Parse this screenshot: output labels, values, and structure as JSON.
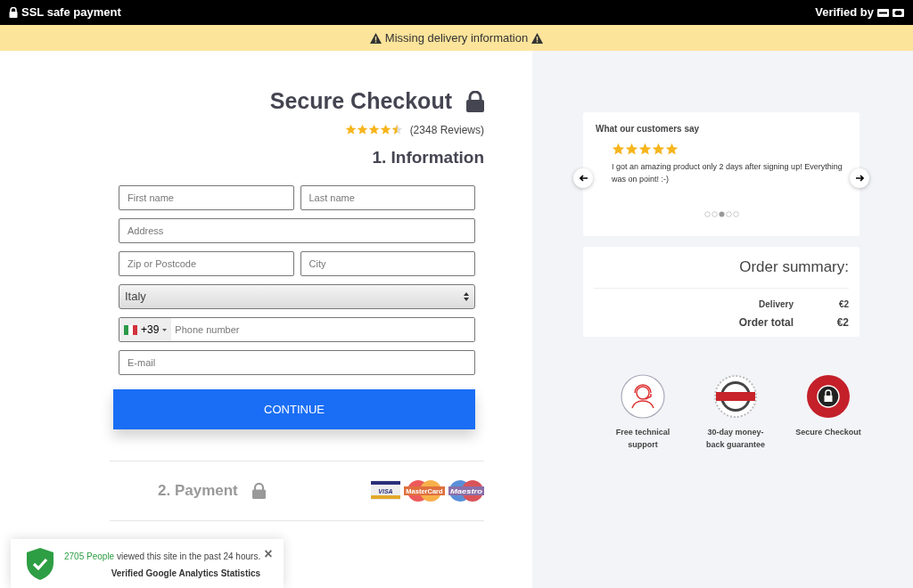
{
  "top_bar": {
    "left_text": "SSL safe payment",
    "right_text": "Verified by"
  },
  "alert": {
    "text": "Missing delivery information"
  },
  "checkout": {
    "title": "Secure Checkout",
    "stars": 4.5,
    "reviews": "(2348 Reviews)",
    "step_title": "1. Information"
  },
  "form_rows": [
    [
      {
        "kind": "text",
        "placeholder": "First name"
      },
      {
        "kind": "text",
        "placeholder": "Last name"
      }
    ],
    [
      {
        "kind": "text",
        "placeholder": "Address"
      }
    ],
    [
      {
        "kind": "text",
        "placeholder": "Zip or Postcode"
      },
      {
        "kind": "text",
        "placeholder": "City"
      }
    ],
    [
      {
        "kind": "select",
        "value": "Italy"
      }
    ],
    [
      {
        "kind": "phone",
        "dial_code": "+39",
        "placeholder": "Phone number"
      }
    ],
    [
      {
        "kind": "text",
        "placeholder": "E-mail"
      }
    ]
  ],
  "continue_button": "CONTINUE",
  "payment": {
    "title": "2. Payment",
    "cards": [
      {
        "kind": "visa",
        "label": "VISA"
      },
      {
        "kind": "mastercard",
        "label": "MasterCard"
      },
      {
        "kind": "maestro",
        "label": "Maestro"
      }
    ]
  },
  "testimonial": {
    "title": "What our customers say",
    "stars": 5,
    "quote": "I got an amazing product only 2 days after signing up! Everything was on point! :-)",
    "dots": [
      {
        "selected": false
      },
      {
        "selected": false
      },
      {
        "selected": true
      },
      {
        "selected": false
      },
      {
        "selected": false
      }
    ]
  },
  "order_summary": {
    "title": "Order summary:",
    "rows": [
      {
        "label": "Delivery",
        "value": "€2",
        "total": false
      },
      {
        "label": "Order total",
        "value": "€2",
        "total": true
      }
    ]
  },
  "badges": [
    {
      "kind": "support",
      "label": "Free technical support"
    },
    {
      "kind": "money_back",
      "label": "30-day money-back guarantee"
    },
    {
      "kind": "secure",
      "label": "Secure Checkout"
    }
  ],
  "toast": {
    "count_text": "2705 People",
    "text": "viewed this site in the past 24 hours.",
    "subtitle": "Verified Google Analytics Statistics",
    "close": "×"
  }
}
